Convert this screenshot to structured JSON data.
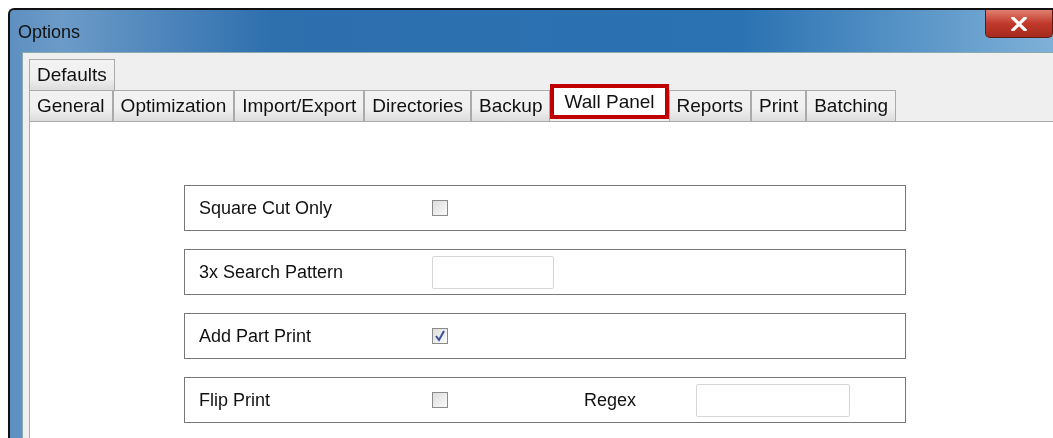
{
  "window": {
    "title": "Options"
  },
  "tab_rows": [
    {
      "tabs": [
        {
          "label": "Defaults",
          "selected": false
        }
      ]
    },
    {
      "tabs": [
        {
          "label": "General",
          "selected": false
        },
        {
          "label": "Optimization",
          "selected": false
        },
        {
          "label": "Import/Export",
          "selected": false
        },
        {
          "label": "Directories",
          "selected": false
        },
        {
          "label": "Backup",
          "selected": false
        },
        {
          "label": "Wall Panel",
          "selected": true
        },
        {
          "label": "Reports",
          "selected": false
        },
        {
          "label": "Print",
          "selected": false
        },
        {
          "label": "Batching",
          "selected": false
        }
      ]
    }
  ],
  "settings": [
    {
      "kind": "checkbox",
      "label": "Square Cut Only",
      "checked": false
    },
    {
      "kind": "text",
      "label": "3x Search Pattern"
    },
    {
      "kind": "checkbox",
      "label": "Add Part Print",
      "checked": true
    },
    {
      "kind": "checkbox",
      "label": "Flip Print",
      "checked": false,
      "extra_label": "Regex"
    }
  ]
}
